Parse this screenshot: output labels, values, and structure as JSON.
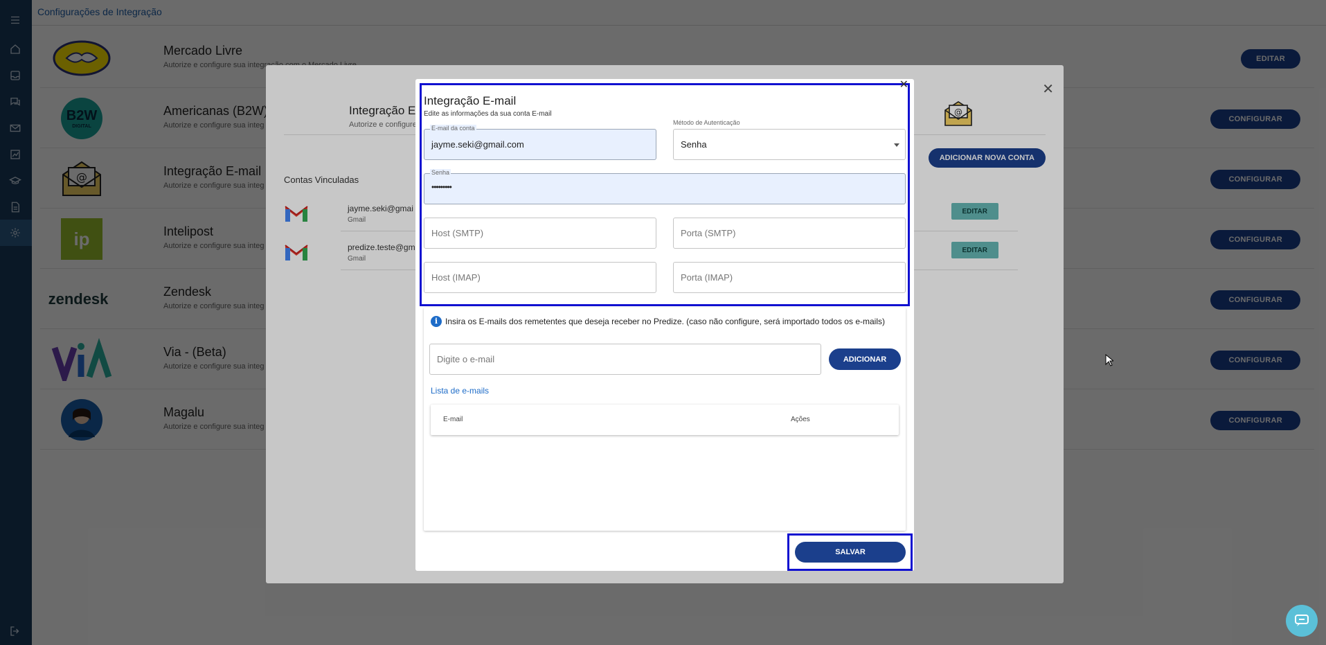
{
  "page": {
    "title": "Configurações de Integração"
  },
  "sidebar": {
    "icons": [
      "menu-icon",
      "home-icon",
      "inbox-icon",
      "chat-icon",
      "mail-icon",
      "chart-icon",
      "school-icon",
      "document-icon",
      "settings-icon",
      "logout-icon"
    ]
  },
  "integrations": [
    {
      "title": "Mercado Livre",
      "desc": "Autorize e configure sua integração com o Mercado Livre",
      "button": "EDITAR",
      "logo": "mercado-livre-logo"
    },
    {
      "title": "Americanas (B2W)",
      "desc": "Autorize e configure sua integ",
      "button": "CONFIGURAR",
      "logo": "b2w-logo"
    },
    {
      "title": "Integração E-mail",
      "desc": "Autorize e configure sua integ",
      "button": "CONFIGURAR",
      "logo": "email-logo"
    },
    {
      "title": "Intelipost",
      "desc": "Autorize e configure sua integ",
      "button": "CONFIGURAR",
      "logo": "intelipost-logo"
    },
    {
      "title": "Zendesk",
      "desc": "Autorize e configure sua integ",
      "button": "CONFIGURAR",
      "logo": "zendesk-logo"
    },
    {
      "title": "Via - (Beta)",
      "desc": "Autorize e configure sua integ",
      "button": "CONFIGURAR",
      "logo": "via-logo"
    },
    {
      "title": "Magalu",
      "desc": "Autorize e configure sua integ",
      "button": "CONFIGURAR",
      "logo": "magalu-logo"
    }
  ],
  "logos": {
    "b2w_text": "B2W",
    "b2w_sub": "DIGITAL",
    "intelipost_text": "ip",
    "zendesk_text": "zendesk"
  },
  "account_dialog": {
    "title": "Integração E-",
    "desc": "Autorize e configure",
    "add_button": "ADICIONAR NOVA CONTA",
    "accounts_title": "Contas Vinculadas",
    "accounts": [
      {
        "email": "jayme.seki@gmai",
        "provider": "Gmail",
        "edit": "EDITAR"
      },
      {
        "email": "predize.teste@gm",
        "provider": "Gmail",
        "edit": "EDITAR"
      }
    ]
  },
  "email_dialog": {
    "title": "Integração E-mail",
    "subtitle": "Edite as informações da sua conta E-mail",
    "account_email": {
      "label": "E-mail da conta",
      "value": "jayme.seki@gmail.com"
    },
    "auth_method": {
      "label": "Método de Autenticação",
      "value": "Senha"
    },
    "password": {
      "label": "Senha",
      "value": "•••••••••"
    },
    "smtp_host_placeholder": "Host (SMTP)",
    "smtp_port_placeholder": "Porta (SMTP)",
    "imap_host_placeholder": "Host (IMAP)",
    "imap_port_placeholder": "Porta (IMAP)",
    "info_text": "Insira os E-mails dos remetentes que deseja receber no Predize. (caso não configure, será importado todos os e-mails)",
    "email_input_placeholder": "Digite o e-mail",
    "add_button": "ADICIONAR",
    "list_title": "Lista de e-mails",
    "table_headers": {
      "email": "E-mail",
      "actions": "Ações"
    },
    "save_button": "SALVAR"
  },
  "colors": {
    "primary": "#1b3f8c",
    "sidebar": "#1b3a5c",
    "highlight": "#1010d0",
    "link": "#1e6cc8",
    "edit_button": "#66b7b4"
  }
}
